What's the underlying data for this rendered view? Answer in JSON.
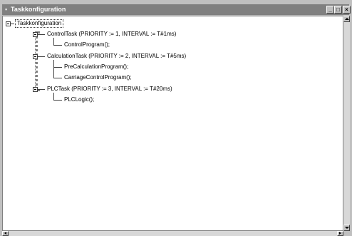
{
  "window": {
    "title": "Taskkonfiguration",
    "buttons": {
      "minimize": "_",
      "maximize": "□",
      "close": "×"
    }
  },
  "tree": {
    "root": "Taskkonfiguration",
    "tasks": [
      {
        "label": "ControlTask (PRIORITY := 1, INTERVAL := T#1ms)",
        "programs": [
          "ControlProgram();"
        ]
      },
      {
        "label": "CalculationTask (PRIORITY := 2, INTERVAL := T#5ms)",
        "programs": [
          "PreCalculationProgram();",
          "CarriageControlProgram();"
        ]
      },
      {
        "label": "PLCTask (PRIORITY := 3, INTERVAL := T#20ms)",
        "programs": [
          "PLCLogic();"
        ]
      }
    ]
  },
  "colors": {
    "titlebar": "#808080",
    "face": "#c0c0c0",
    "window": "#ffffff"
  }
}
